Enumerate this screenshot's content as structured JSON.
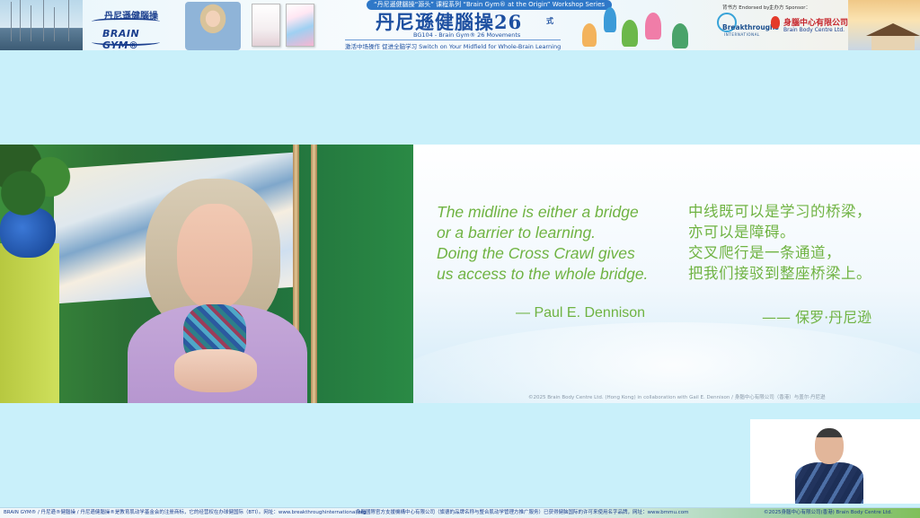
{
  "banner": {
    "logo_cn": "丹尼遜健腦操",
    "logo_en": "BRAIN GYM®",
    "series_pill": "“丹尼遜健腦操“源头” 课程系列  “Brain Gym® at the Origin”  Workshop Series",
    "main_title": "丹尼遜健腦操",
    "main_title_num": "26",
    "main_title_suffix": "式",
    "subline": "BG104 - Brain Gym® 26 Movements",
    "tagline": "激活中场操作 促进全脑学习 Switch on Your Midfield for Whole-Brain Learning",
    "endorsed_label": "背书方 Endorsed by：",
    "sponsor_label": "主办方 Sponsor：",
    "endorser_name": "Breakthroughs",
    "endorser_sub": "INTERNATIONAL",
    "sponsor_cn": "身腦中心有限公司®",
    "sponsor_en": "Brain Body Centre Ltd."
  },
  "slide": {
    "quote_en": [
      "The midline is either a bridge",
      "or a barrier to learning.",
      "Doing the Cross Crawl gives",
      "us access to the whole bridge."
    ],
    "quote_cn": [
      "中线既可以是学习的桥梁，",
      "亦可以是障碍。",
      "交叉爬行是一条通道，",
      "把我们接驳到整座桥梁上。"
    ],
    "attribution_en": "— Paul E. Dennison",
    "attribution_cn": "—— 保罗·丹尼逊",
    "copyright": "©2025 Brain Body Centre Ltd. (Hong Kong) in collaboration with Gail E. Dennison / 身腦中心有限公司（香港）与盖尔·丹尼逊"
  },
  "ticker": {
    "left": "BRAIN GYM® / 丹尼遜®健腦操 / 丹尼遜健腦操®是教育肌动学基金会的注册商标，它的经营权在办球健国际（BTI）。网址：www.breakthroughinternational.org",
    "middle": "身腦國際官方支援機構中心有限公司（旗德的品牌名称与整合肌动学管理方推广服务）已获得健脑国际的许可来使用名字品牌，网址：www.bmmu.com",
    "right": "©2025身腦中心有限公司(香港) Brain Body Centre Ltd."
  },
  "colors": {
    "page_bg": "#c9f0fa",
    "quote_green": "#6fb342",
    "brand_blue": "#1d4fa0"
  }
}
